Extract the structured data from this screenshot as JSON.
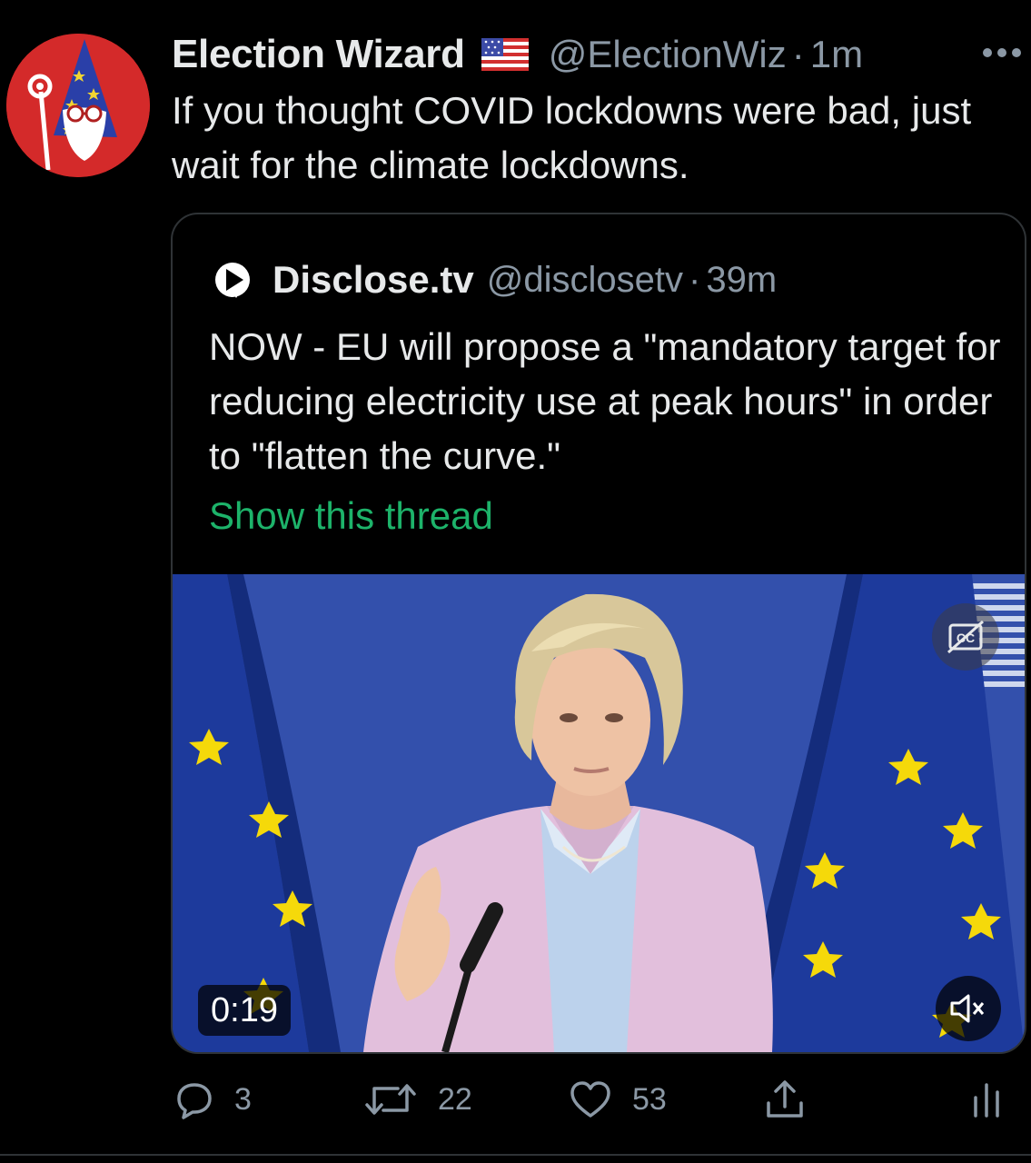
{
  "tweet": {
    "author": {
      "display_name": "Election Wizard",
      "flag": "🇺🇸",
      "handle": "@ElectionWiz",
      "separator": "·",
      "timestamp": "1m",
      "avatar_icon": "wizard-avatar-icon"
    },
    "text": "If you thought COVID lockdowns were bad, just wait for the climate lockdowns.",
    "more_icon": "more-horizontal-icon"
  },
  "quote": {
    "author": {
      "display_name": "Disclose.tv",
      "handle": "@disclosetv",
      "separator": "·",
      "timestamp": "39m",
      "logo_icon": "disclose-logo-icon"
    },
    "text": "NOW - EU will propose a \"mandatory target for reducing electricity use at peak hours\" in order to \"flatten the curve.\"",
    "show_thread": "Show this thread",
    "video": {
      "duration": "0:19",
      "captions_icon": "closed-captions-icon",
      "mute_icon": "muted-speaker-icon"
    }
  },
  "actions": {
    "reply_count": "3",
    "retweet_count": "22",
    "like_count": "53"
  },
  "colors": {
    "background": "#000000",
    "text": "#e7e9ea",
    "secondary": "#8b98a5",
    "accent_green": "#1db36a",
    "border": "#2f3336"
  }
}
